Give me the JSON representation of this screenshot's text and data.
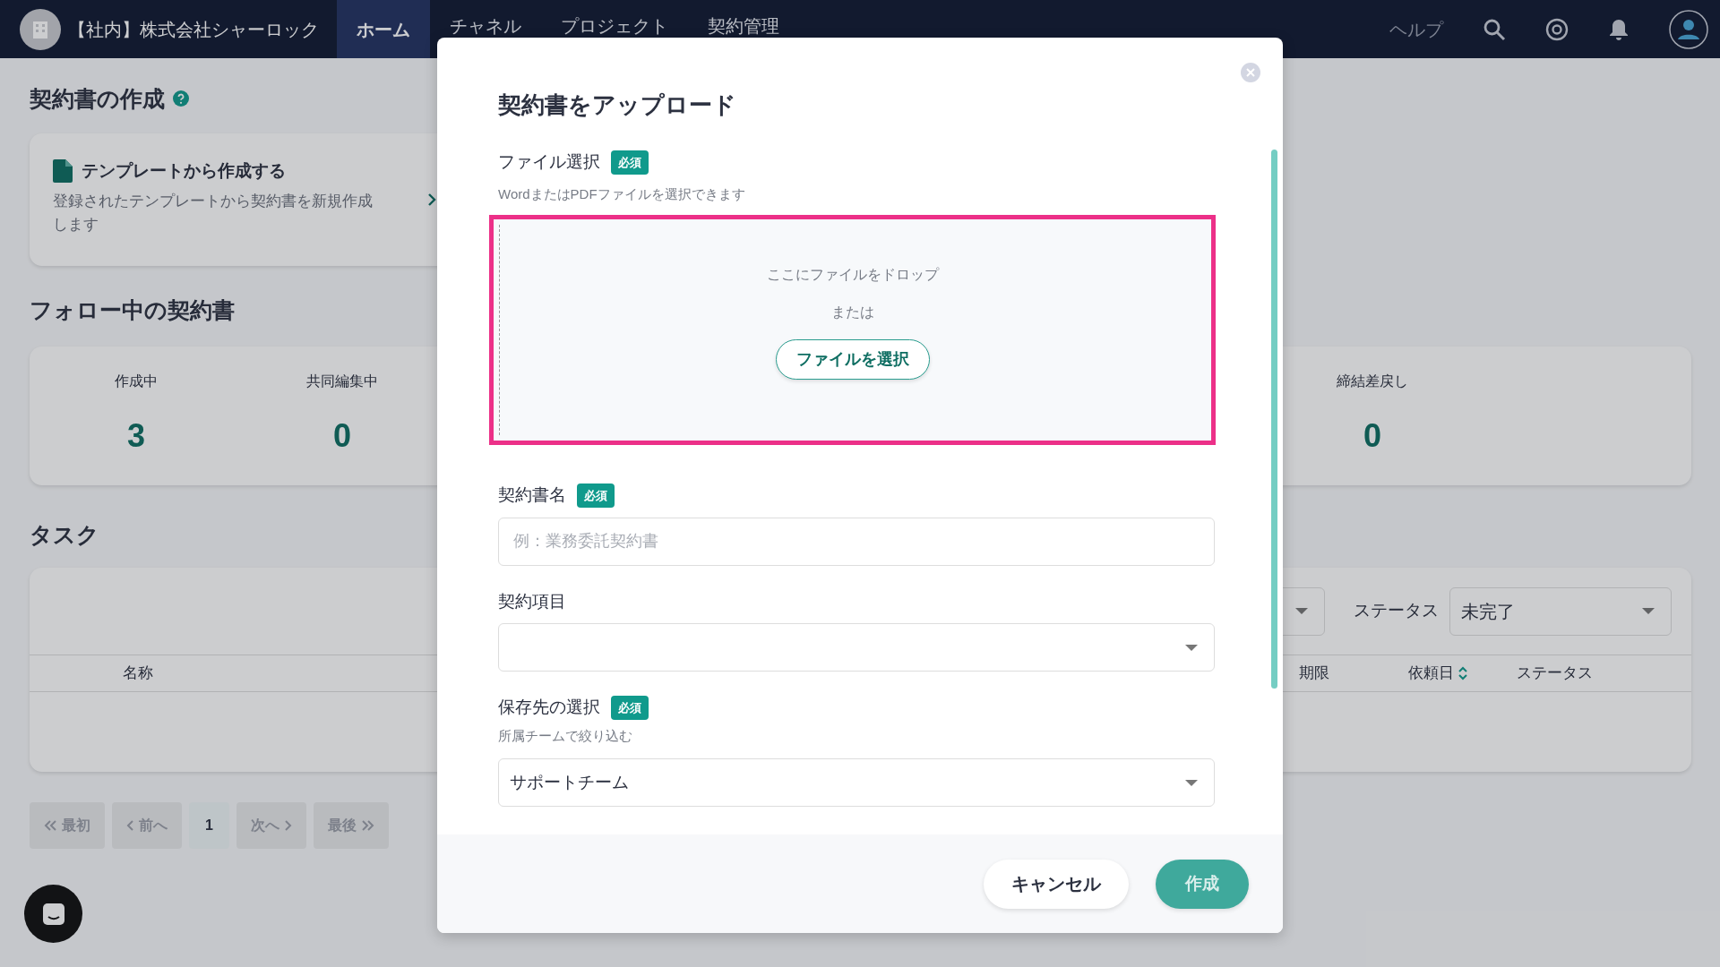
{
  "navbar": {
    "company": "【社内】株式会社シャーロック",
    "tabs": [
      {
        "label": "ホーム",
        "selected": true
      },
      {
        "label": "チャネル",
        "selected": false
      },
      {
        "label": "プロジェクト",
        "selected": false
      },
      {
        "label": "契約管理",
        "selected": false
      }
    ],
    "help": "ヘルプ"
  },
  "create_section": {
    "title": "契約書の作成",
    "template_card": {
      "title": "テンプレートから作成する",
      "description": "登録されたテンプレートから契約書を新規作成します"
    }
  },
  "following": {
    "title": "フォロー中の契約書",
    "stats": [
      {
        "label": "作成中",
        "value": "3"
      },
      {
        "label": "共同編集中",
        "value": "0"
      },
      {
        "label": "締結差戻し",
        "value": "0"
      }
    ]
  },
  "tasks": {
    "title": "タスク",
    "status_filter": {
      "label": "ステータス",
      "value": "未完了"
    },
    "columns": [
      "名称",
      "期限",
      "依頼日",
      "ステータス"
    ],
    "pagination": [
      {
        "kind": "first",
        "label": "最初",
        "selected": false
      },
      {
        "kind": "prev",
        "label": "前へ",
        "selected": false
      },
      {
        "kind": "page",
        "label": "1",
        "selected": true
      },
      {
        "kind": "next",
        "label": "次へ",
        "selected": false
      },
      {
        "kind": "last",
        "label": "最後",
        "selected": false
      }
    ]
  },
  "modal": {
    "title": "契約書をアップロード",
    "file": {
      "label": "ファイル選択",
      "required": "必須",
      "hint": "WordまたはPDFファイルを選択できます",
      "drop_text": "ここにファイルをドロップ",
      "or_text": "または",
      "button": "ファイルを選択"
    },
    "name_field": {
      "label": "契約書名",
      "required": "必須",
      "placeholder": "例：業務委託契約書"
    },
    "item_field": {
      "label": "契約項目"
    },
    "destination": {
      "label": "保存先の選択",
      "required": "必須",
      "hint": "所属チームで絞り込む",
      "value": "サポートチーム"
    },
    "buttons": {
      "cancel": "キャンセル",
      "submit": "作成"
    }
  }
}
